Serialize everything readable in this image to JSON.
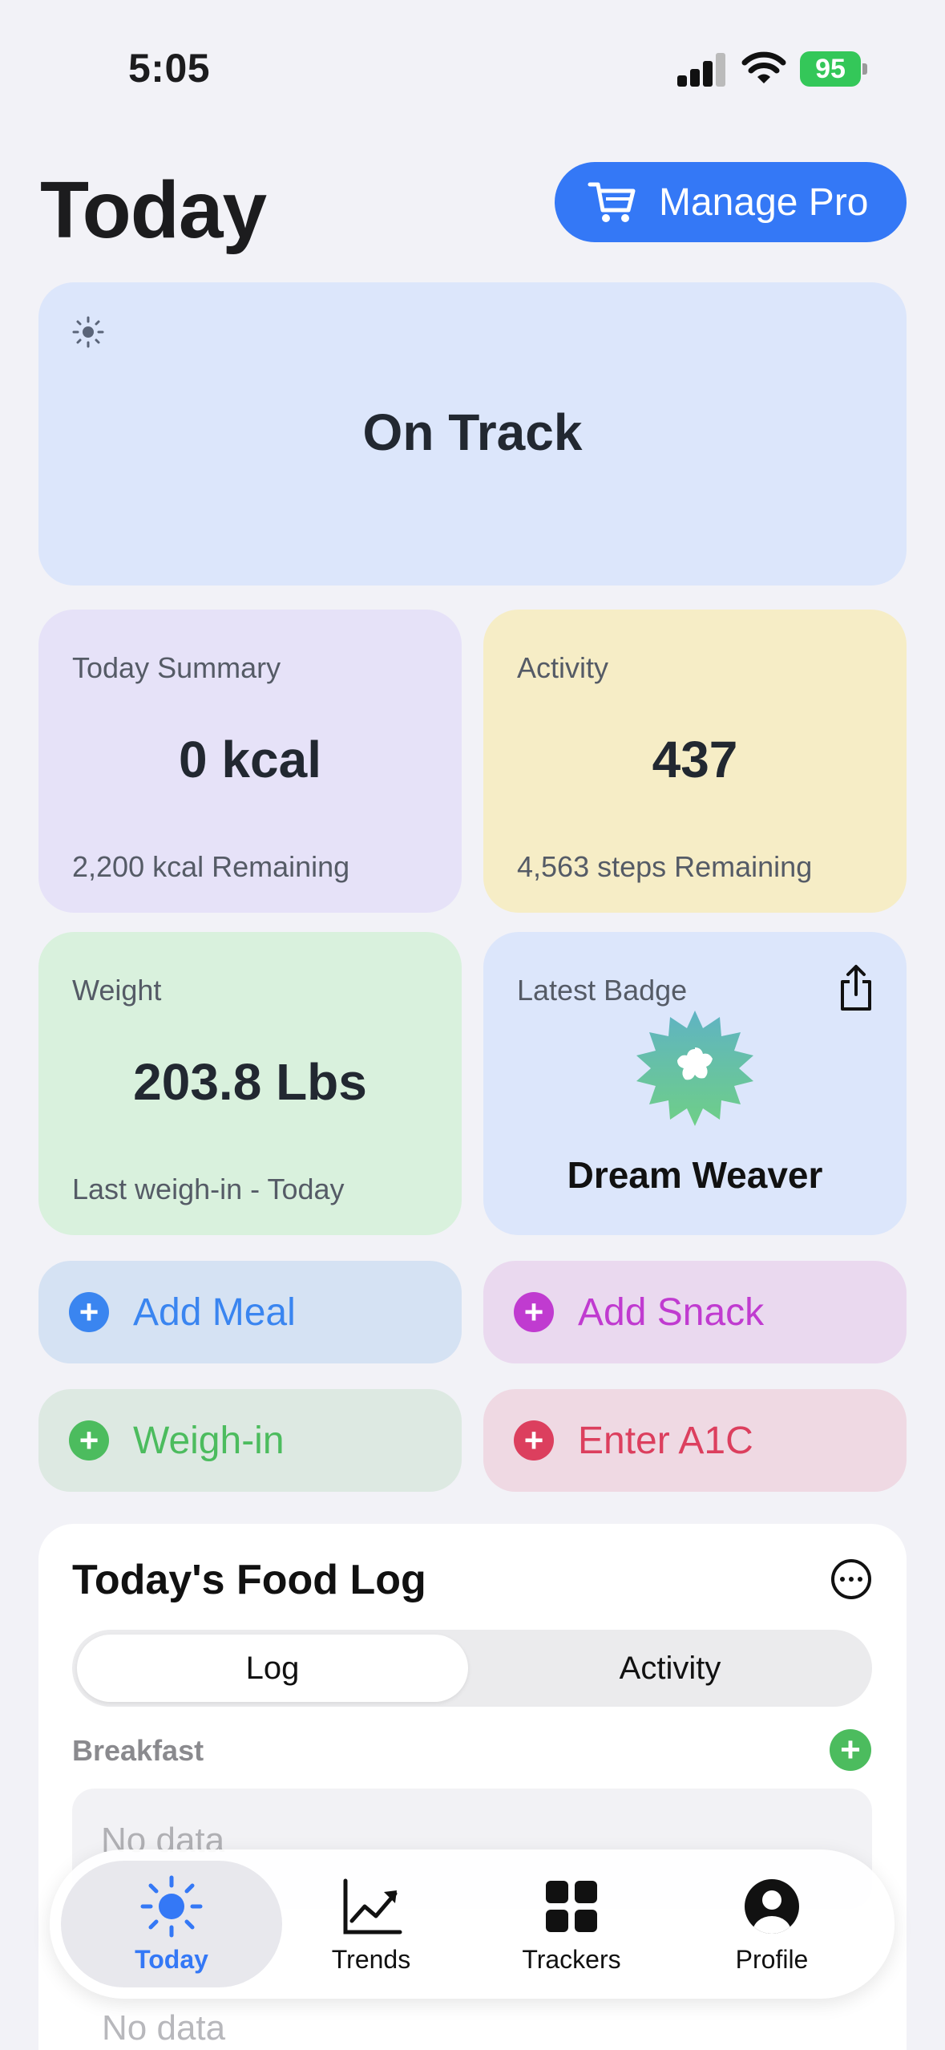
{
  "status_bar": {
    "time": "5:05",
    "battery": "95"
  },
  "header": {
    "title": "Today",
    "pro_button": "Manage Pro"
  },
  "status_card": {
    "text": "On Track"
  },
  "summary": {
    "label": "Today Summary",
    "value": "0 kcal",
    "sub": "2,200 kcal Remaining"
  },
  "activity": {
    "label": "Activity",
    "value": "437",
    "sub": "4,563 steps Remaining"
  },
  "weight": {
    "label": "Weight",
    "value": "203.8 Lbs",
    "sub": "Last weigh-in - Today"
  },
  "badge": {
    "label": "Latest Badge",
    "name": "Dream Weaver"
  },
  "actions": {
    "add_meal": "Add Meal",
    "add_snack": "Add Snack",
    "weigh_in": "Weigh-in",
    "enter_a1c": "Enter A1C"
  },
  "food_log": {
    "title": "Today's Food Log",
    "segments": [
      "Log",
      "Activity"
    ],
    "selected_segment": "Log",
    "breakfast_label": "Breakfast",
    "empty_text": "No data"
  },
  "tabbar": {
    "tabs": [
      {
        "label": "Today",
        "icon": "sun-icon",
        "selected": true
      },
      {
        "label": "Trends",
        "icon": "chart-icon",
        "selected": false
      },
      {
        "label": "Trackers",
        "icon": "grid-icon",
        "selected": false
      },
      {
        "label": "Profile",
        "icon": "person-icon",
        "selected": false
      }
    ]
  },
  "colors": {
    "accent": "#3478f6",
    "meal": "#3a85f0",
    "snack": "#c03bd0",
    "weigh": "#4cbc5e",
    "a1c": "#dc3f5e"
  }
}
